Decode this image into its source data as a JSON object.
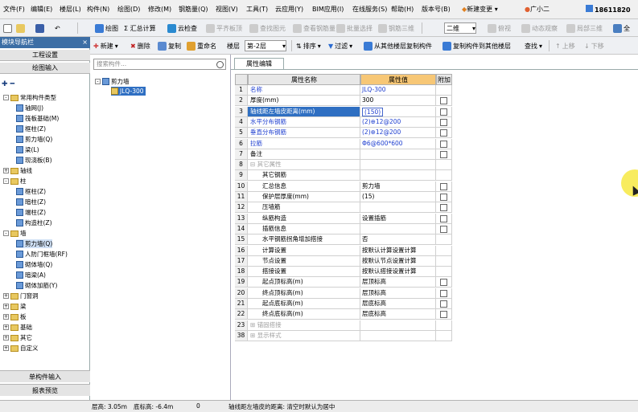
{
  "menu": [
    "文件(F)",
    "编辑(E)",
    "楼层(L)",
    "构件(N)",
    "绘图(D)",
    "修改(M)",
    "钢筋量(Q)",
    "视图(V)",
    "工具(T)",
    "云应用(Y)",
    "BIM应用(I)",
    "在线服务(S)",
    "帮助(H)",
    "版本号(B)"
  ],
  "menu_extra": {
    "new_change": "新建变更",
    "user_name": "广小二",
    "phone": "18611820"
  },
  "toolbar1": {
    "draw": "绘图",
    "sum": "Σ 汇总计算",
    "cloud_check": "云检查",
    "flat_slab": "平齐板顶",
    "find_element": "查找图元",
    "view_rebar": "查看钢筋量",
    "batch_select": "批量选择",
    "rebar_3d": "钢筋三维",
    "dim": "二维",
    "top_view": "俯视",
    "dynamic": "动态观察",
    "local_3d": "局部三维",
    "full": "全"
  },
  "toolbar2": {
    "new": "新建",
    "delete": "删除",
    "copy": "复制",
    "rename": "重命名",
    "floor_label": "楼层",
    "floor_value": "第-2层",
    "sort": "排序",
    "filter": "过滤",
    "copy_from_floor": "从其他楼层复制构件",
    "copy_to_floor": "复制构件到其他楼层",
    "find": "查找",
    "up": "上移",
    "down": "下移"
  },
  "nav": {
    "header": "模块导航栏",
    "close": "×",
    "tab1": "工程设置",
    "tab2": "绘图输入",
    "tree": [
      {
        "label": "常用构件类型",
        "indent": 0,
        "type": "folder",
        "exp": "-"
      },
      {
        "label": "轴网(J)",
        "indent": 1,
        "type": "item"
      },
      {
        "label": "筏板基础(M)",
        "indent": 1,
        "type": "item"
      },
      {
        "label": "框柱(Z)",
        "indent": 1,
        "type": "item"
      },
      {
        "label": "剪力墙(Q)",
        "indent": 1,
        "type": "item"
      },
      {
        "label": "梁(L)",
        "indent": 1,
        "type": "item"
      },
      {
        "label": "现浇板(B)",
        "indent": 1,
        "type": "item"
      },
      {
        "label": "轴线",
        "indent": 0,
        "type": "folder",
        "exp": "+"
      },
      {
        "label": "柱",
        "indent": 0,
        "type": "folder",
        "exp": "-"
      },
      {
        "label": "框柱(Z)",
        "indent": 1,
        "type": "item"
      },
      {
        "label": "暗柱(Z)",
        "indent": 1,
        "type": "item"
      },
      {
        "label": "端柱(Z)",
        "indent": 1,
        "type": "item"
      },
      {
        "label": "构造柱(Z)",
        "indent": 1,
        "type": "item"
      },
      {
        "label": "墙",
        "indent": 0,
        "type": "folder",
        "exp": "-"
      },
      {
        "label": "剪力墙(Q)",
        "indent": 1,
        "type": "item",
        "selected": true
      },
      {
        "label": "人防门框墙(RF)",
        "indent": 1,
        "type": "item"
      },
      {
        "label": "砌体墙(Q)",
        "indent": 1,
        "type": "item"
      },
      {
        "label": "暗梁(A)",
        "indent": 1,
        "type": "item"
      },
      {
        "label": "砌体加筋(Y)",
        "indent": 1,
        "type": "item"
      },
      {
        "label": "门窗洞",
        "indent": 0,
        "type": "folder",
        "exp": "+"
      },
      {
        "label": "梁",
        "indent": 0,
        "type": "folder",
        "exp": "+"
      },
      {
        "label": "板",
        "indent": 0,
        "type": "folder",
        "exp": "+"
      },
      {
        "label": "基础",
        "indent": 0,
        "type": "folder",
        "exp": "+"
      },
      {
        "label": "其它",
        "indent": 0,
        "type": "folder",
        "exp": "+"
      },
      {
        "label": "自定义",
        "indent": 0,
        "type": "folder",
        "exp": "+"
      }
    ],
    "bottom1": "单构件输入",
    "bottom2": "报表预览"
  },
  "component_list": {
    "search_placeholder": "搜索构件...",
    "root": "剪力墙",
    "child": "JLQ-300"
  },
  "props": {
    "tab": "属性编辑",
    "headers": {
      "name": "属性名称",
      "value": "属性值",
      "extra": "附加"
    },
    "rows": [
      {
        "num": "1",
        "name": "名称",
        "value": "JLQ-300",
        "blue": true,
        "check": false
      },
      {
        "num": "2",
        "name": "厚度(mm)",
        "value": "300",
        "check": true
      },
      {
        "num": "3",
        "name": "轴线距左墙皮距离(mm)",
        "value": "(150)",
        "selected": true,
        "check": true
      },
      {
        "num": "4",
        "name": "水平分布钢筋",
        "value": "(2)⊕12@200",
        "blue": true,
        "check": true
      },
      {
        "num": "5",
        "name": "垂直分布钢筋",
        "value": "(2)⊕12@200",
        "blue": true,
        "check": true
      },
      {
        "num": "6",
        "name": "拉筋",
        "value": "Φ6@600*600",
        "blue": true,
        "check": true
      },
      {
        "num": "7",
        "name": "备注",
        "value": "",
        "check": true
      },
      {
        "num": "8",
        "name": "⊟ 其它属性",
        "value": "",
        "group": true
      },
      {
        "num": "9",
        "name": "其它钢筋",
        "value": "",
        "sub": true
      },
      {
        "num": "10",
        "name": "汇总信息",
        "value": "剪力墙",
        "sub": true,
        "check": true
      },
      {
        "num": "11",
        "name": "保护层厚度(mm)",
        "value": "(15)",
        "sub": true,
        "check": true
      },
      {
        "num": "12",
        "name": "压墙筋",
        "value": "",
        "sub": true,
        "check": true
      },
      {
        "num": "13",
        "name": "纵筋构造",
        "value": "设置插筋",
        "sub": true,
        "check": true
      },
      {
        "num": "14",
        "name": "插筋信息",
        "value": "",
        "sub": true,
        "check": true
      },
      {
        "num": "15",
        "name": "水平钢筋拐角增加搭接",
        "value": "否",
        "sub": true
      },
      {
        "num": "16",
        "name": "计算设置",
        "value": "按默认计算设置计算",
        "sub": true
      },
      {
        "num": "17",
        "name": "节点设置",
        "value": "按默认节点设置计算",
        "sub": true
      },
      {
        "num": "18",
        "name": "搭接设置",
        "value": "按默认搭接设置计算",
        "sub": true
      },
      {
        "num": "19",
        "name": "起点顶标高(m)",
        "value": "层顶标高",
        "sub": true,
        "check": true
      },
      {
        "num": "20",
        "name": "终点顶标高(m)",
        "value": "层顶标高",
        "sub": true,
        "check": true
      },
      {
        "num": "21",
        "name": "起点底标高(m)",
        "value": "层底标高",
        "sub": true,
        "check": true
      },
      {
        "num": "22",
        "name": "终点底标高(m)",
        "value": "层底标高",
        "sub": true,
        "check": true
      },
      {
        "num": "23",
        "name": "⊞ 锚固搭接",
        "value": "",
        "group": true
      },
      {
        "num": "38",
        "name": "⊞ 显示样式",
        "value": "",
        "group": true
      }
    ]
  },
  "status": {
    "floor_height": "层高: 3.05m",
    "bottom_elev": "底标高: -6.4m",
    "zero": "0",
    "hint": "轴线距左墙皮的距离: 清空时默认为居中"
  }
}
